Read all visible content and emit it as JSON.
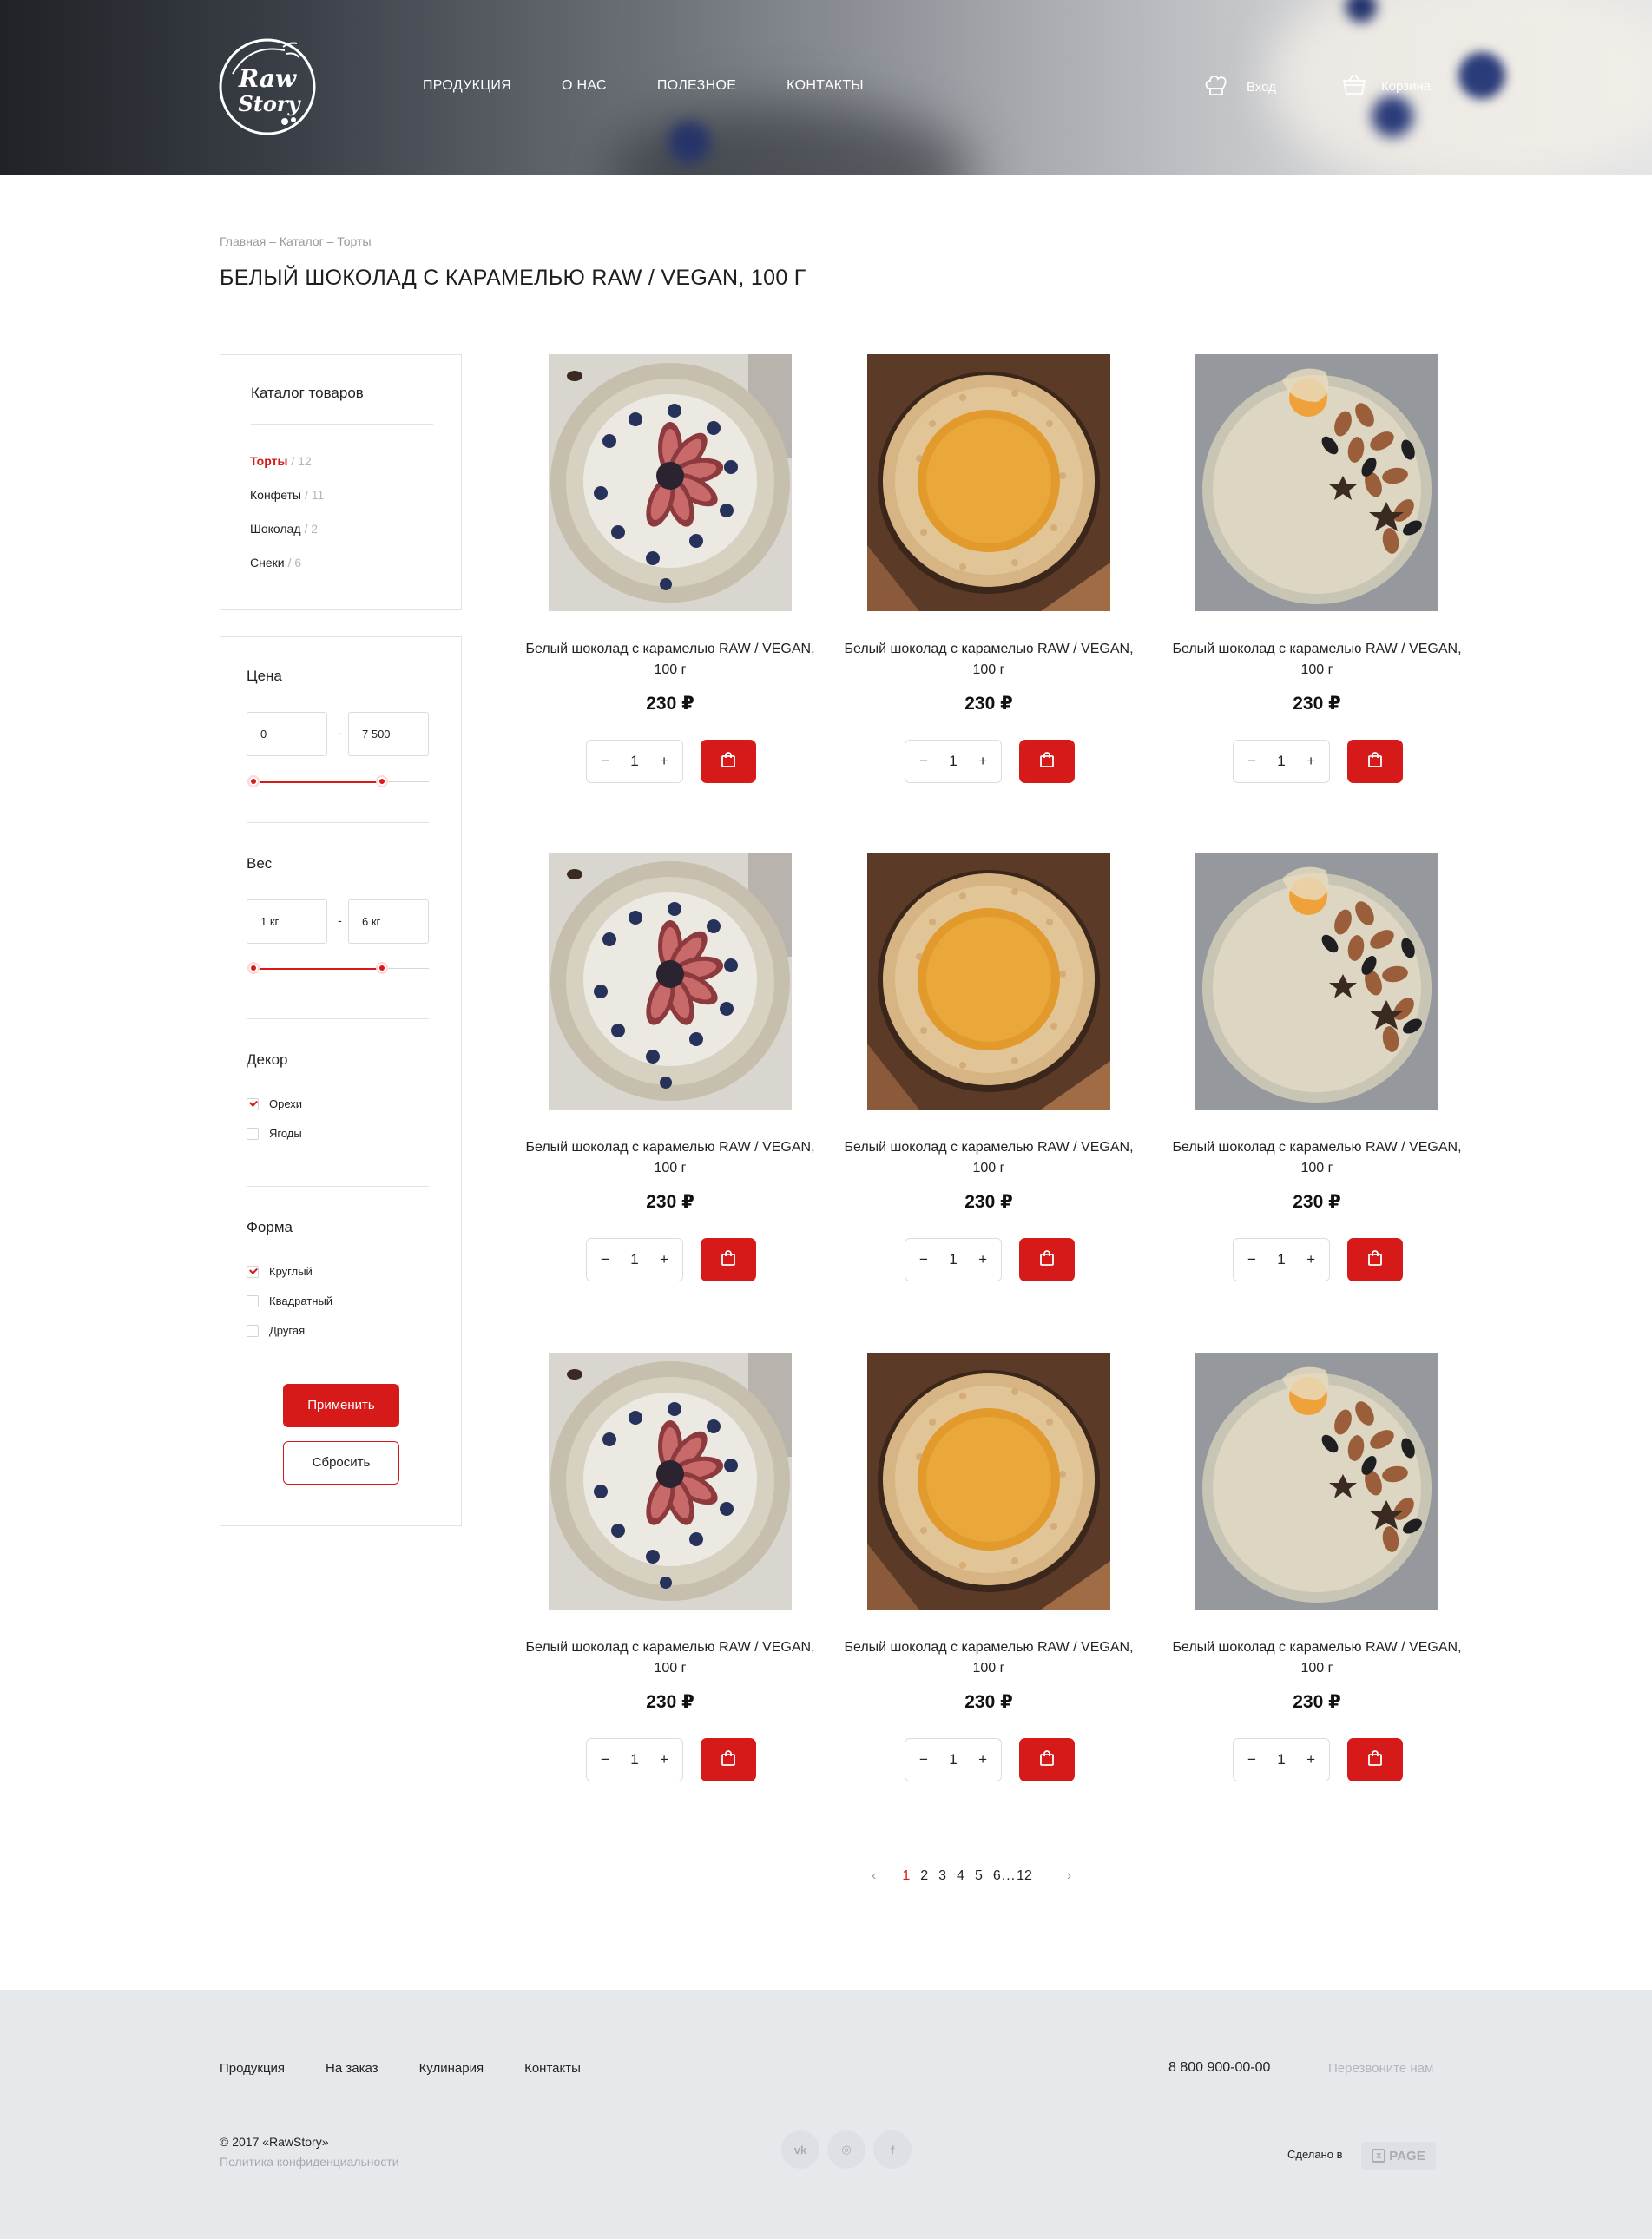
{
  "header": {
    "logo_text": "Raw Story",
    "nav": [
      "ПРОДУКЦИЯ",
      "О НАС",
      "ПОЛЕЗНОЕ",
      "КОНТАКТЫ"
    ],
    "login_label": "Вход",
    "cart_label": "Корзина"
  },
  "breadcrumb": "Главная – Каталог – Торты",
  "page_title": "БЕЛЫЙ ШОКОЛАД С КАРАМЕЛЬЮ RAW / VEGAN, 100 Г",
  "catalog": {
    "title": "Каталог товаров",
    "items": [
      {
        "label": "Торты",
        "count": "12",
        "active": true
      },
      {
        "label": "Конфеты",
        "count": "11",
        "active": false
      },
      {
        "label": "Шоколад",
        "count": "2",
        "active": false
      },
      {
        "label": "Снеки",
        "count": "6",
        "active": false
      }
    ]
  },
  "filters": {
    "price": {
      "title": "Цена",
      "from": "0",
      "to": "7 500"
    },
    "weight": {
      "title": "Вес",
      "from": "1 кг",
      "to": "6 кг"
    },
    "decor": {
      "title": "Декор",
      "options": [
        {
          "label": "Орехи",
          "checked": true
        },
        {
          "label": "Ягоды",
          "checked": false
        }
      ]
    },
    "shape": {
      "title": "Форма",
      "options": [
        {
          "label": "Круглый",
          "checked": true
        },
        {
          "label": "Квадратный",
          "checked": false
        },
        {
          "label": "Другая",
          "checked": false
        }
      ]
    },
    "apply_label": "Применить",
    "reset_label": "Сбросить"
  },
  "products": [
    {
      "name": "Белый шоколад с карамелью RAW / VEGAN, 100 г",
      "price": "230 ₽",
      "qty": "1",
      "image": "fig-cake"
    },
    {
      "name": "Белый шоколад с карамелью RAW / VEGAN, 100 г",
      "price": "230 ₽",
      "qty": "1",
      "image": "caramel-cake"
    },
    {
      "name": "Белый шоколад с карамелью RAW / VEGAN, 100 г",
      "price": "230 ₽",
      "qty": "1",
      "image": "nut-cake"
    },
    {
      "name": "Белый шоколад с карамелью RAW / VEGAN, 100 г",
      "price": "230 ₽",
      "qty": "1",
      "image": "fig-cake"
    },
    {
      "name": "Белый шоколад с карамелью RAW / VEGAN, 100 г",
      "price": "230 ₽",
      "qty": "1",
      "image": "caramel-cake"
    },
    {
      "name": "Белый шоколад с карамелью RAW / VEGAN, 100 г",
      "price": "230 ₽",
      "qty": "1",
      "image": "nut-cake"
    },
    {
      "name": "Белый шоколад с карамелью RAW / VEGAN, 100 г",
      "price": "230 ₽",
      "qty": "1",
      "image": "fig-cake"
    },
    {
      "name": "Белый шоколад с карамелью RAW / VEGAN, 100 г",
      "price": "230 ₽",
      "qty": "1",
      "image": "caramel-cake"
    },
    {
      "name": "Белый шоколад с карамелью RAW / VEGAN, 100 г",
      "price": "230 ₽",
      "qty": "1",
      "image": "nut-cake"
    }
  ],
  "pagination": {
    "prev": "‹",
    "pages": [
      "1",
      "2",
      "3",
      "4",
      "5",
      "6"
    ],
    "ellipsis": "...",
    "last": "12",
    "next": "›",
    "current": "1"
  },
  "footer": {
    "nav": [
      "Продукция",
      "На заказ",
      "Кулинария",
      "Контакты"
    ],
    "phone": "8 800 900-00-00",
    "callback": "Перезвоните нам",
    "copyright": "© 2017 «RawStory»",
    "policy": "Политика конфиденциальности",
    "social": [
      {
        "name": "vk-icon",
        "glyph": "vk"
      },
      {
        "name": "instagram-icon",
        "glyph": "◎"
      },
      {
        "name": "facebook-icon",
        "glyph": "f"
      }
    ],
    "made_by": "Сделано в",
    "made_brand": "PAGE"
  },
  "colors": {
    "accent": "#d61a1a",
    "footer_bg": "#e6e9ec"
  }
}
